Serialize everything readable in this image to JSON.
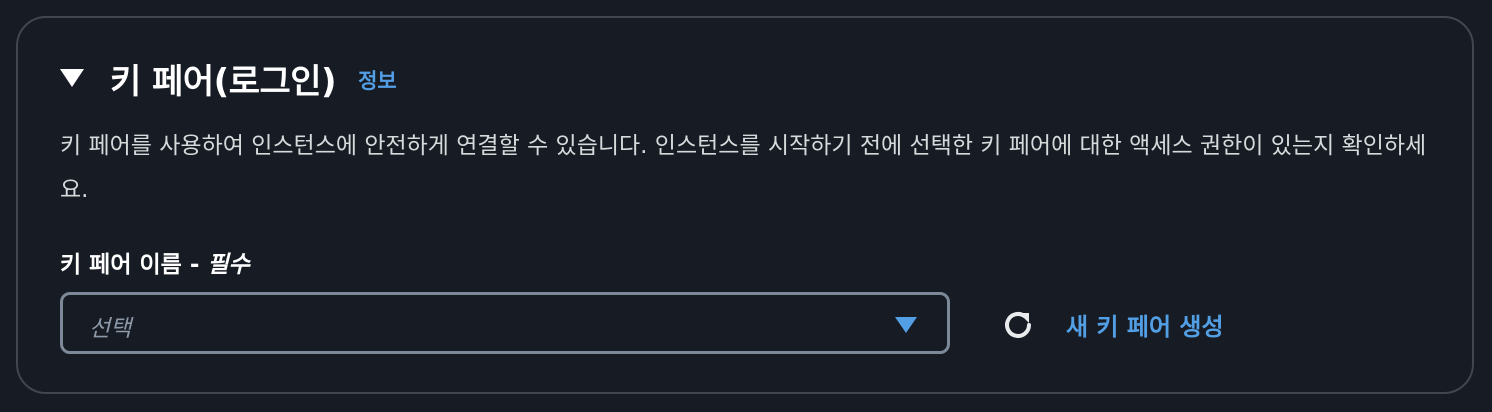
{
  "section": {
    "title": "키 페어(로그인)",
    "info_link": "정보",
    "description": "키 페어를 사용하여 인스턴스에 안전하게 연결할 수 있습니다. 인스턴스를 시작하기 전에 선택한 키 페어에 대한 액세스 권한이 있는지 확인하세요.",
    "expanded_icon": "caret-down-icon"
  },
  "key_pair_field": {
    "label": "키 페어 이름 -",
    "required_label": "필수",
    "placeholder": "선택",
    "dropdown_icon": "chevron-down-icon"
  },
  "actions": {
    "refresh_icon": "refresh-icon",
    "create_label": "새 키 페어 생성"
  },
  "colors": {
    "background": "#161b24",
    "border": "#414750",
    "link": "#539fe5",
    "text": "#d5dbdb",
    "heading": "#ffffff"
  }
}
